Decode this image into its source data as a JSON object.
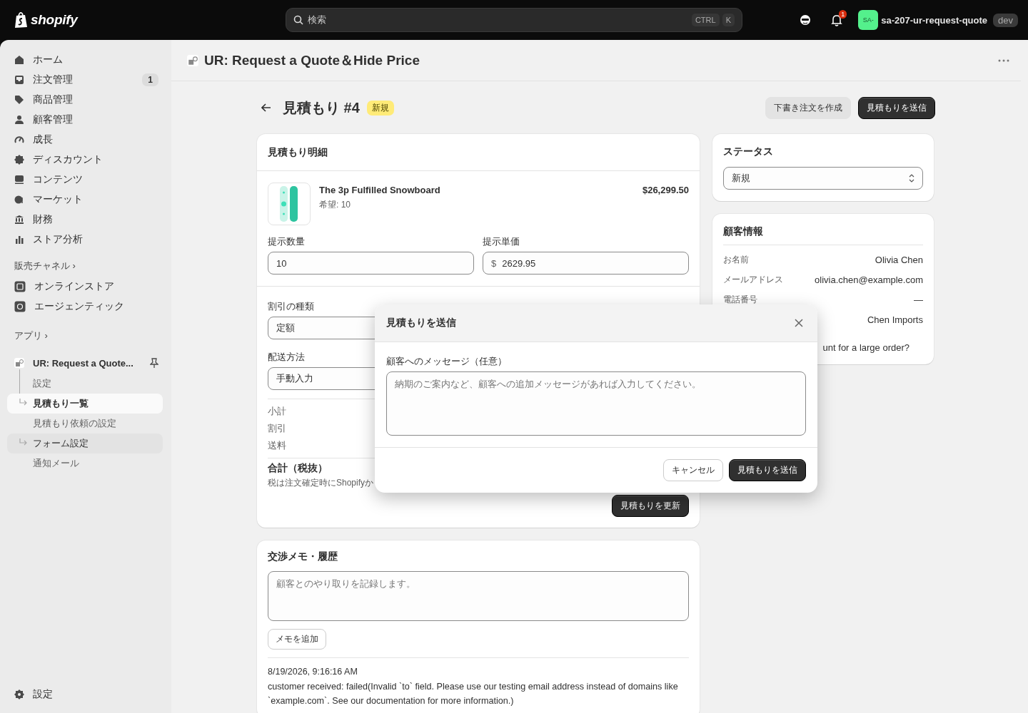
{
  "topbar": {
    "logo": "shopify",
    "search": {
      "placeholder": "検索",
      "keys": [
        "CTRL",
        "K"
      ]
    },
    "notifications": {
      "count": "1"
    },
    "store": {
      "avatar": "SA-",
      "name": "sa-207-ur-request-quote",
      "env": "dev"
    }
  },
  "sidebar": {
    "items": [
      {
        "label": "ホーム",
        "selected": false
      },
      {
        "label": "注文管理",
        "badge": "1",
        "selected": false
      },
      {
        "label": "商品管理",
        "selected": false
      },
      {
        "label": "顧客管理",
        "selected": false
      },
      {
        "label": "成長",
        "selected": false
      },
      {
        "label": "ディスカウント",
        "selected": false
      },
      {
        "label": "コンテンツ",
        "selected": false
      },
      {
        "label": "マーケット",
        "selected": false
      },
      {
        "label": "財務",
        "selected": false
      },
      {
        "label": "ストア分析",
        "selected": false
      }
    ],
    "sales_channels": {
      "heading": "販売チャネル",
      "chevron": "›",
      "items": [
        {
          "label": "オンラインストア",
          "selected": false
        },
        {
          "label": "エージェンティック",
          "selected": false
        }
      ]
    },
    "apps": {
      "heading": "アプリ",
      "chevron": "›",
      "app": {
        "label": "UR: Request a Quote...",
        "children": [
          {
            "label": "設定",
            "selected": false,
            "highlighted": false
          },
          {
            "label": "見積もり一覧",
            "selected": true,
            "highlighted": false
          },
          {
            "label": "見積もり依頼の設定",
            "selected": false,
            "highlighted": false
          },
          {
            "label": "フォーム設定",
            "selected": false,
            "highlighted": true
          },
          {
            "label": "通知メール",
            "selected": false,
            "highlighted": false
          }
        ]
      }
    },
    "settings": "設定"
  },
  "page": {
    "app_title": "UR: Request a Quote＆Hide Price",
    "quote": {
      "title": "見積もり #4",
      "status_badge": "新規",
      "actions": [
        {
          "label": "下書き注文を作成",
          "kind": "secondary"
        },
        {
          "label": "見積もりを送信",
          "kind": "primary"
        }
      ]
    },
    "details_card": {
      "title": "見積もり明細",
      "product": {
        "name": "The 3p Fulfilled Snowboard",
        "requested": "希望: 10",
        "total": "$26,299.50"
      },
      "fields": [
        {
          "label": "提示数量",
          "value": "10"
        },
        {
          "label": "提示単価",
          "prefix": "$",
          "value": "2629.95"
        }
      ],
      "discount_type": {
        "label": "割引の種類",
        "value": "定額"
      },
      "shipping_method": {
        "label": "配送方法",
        "value": "手動入力"
      },
      "summary": [
        "小計",
        "割引",
        "送料"
      ],
      "total_label": "合計（税抜）",
      "tax_note": "税は注文確定時にShopifyか",
      "update_button": "見積もりを更新"
    },
    "notes_card": {
      "title": "交渉メモ・履歴",
      "placeholder": "顧客とのやり取りを記録します。",
      "add_button": "メモを追加",
      "history": [
        {
          "time": "8/19/2026, 9:16:16 AM",
          "message": "customer received: failed(Invalid `to` field. Please use our testing email address instead of domains like `example.com`. See our documentation for more information.)"
        }
      ]
    },
    "status_card": {
      "title": "ステータス",
      "value": "新規"
    },
    "customer_card": {
      "title": "顧客情報",
      "rows": [
        {
          "label": "お名前",
          "value": "Olivia Chen"
        },
        {
          "label": "メールアドレス",
          "value": "olivia.chen@example.com"
        },
        {
          "label": "電話番号",
          "value": "—"
        },
        {
          "value": "Chen Imports"
        }
      ],
      "note": "unt for a large order?"
    }
  },
  "modal": {
    "title": "見積もりを送信",
    "field_label": "顧客へのメッセージ（任意）",
    "placeholder": "納期のご案内など、顧客への追加メッセージがあれば入力してください。",
    "buttons": [
      {
        "label": "キャンセル",
        "kind": "secondary"
      },
      {
        "label": "見積もりを送信",
        "kind": "primary"
      }
    ]
  }
}
